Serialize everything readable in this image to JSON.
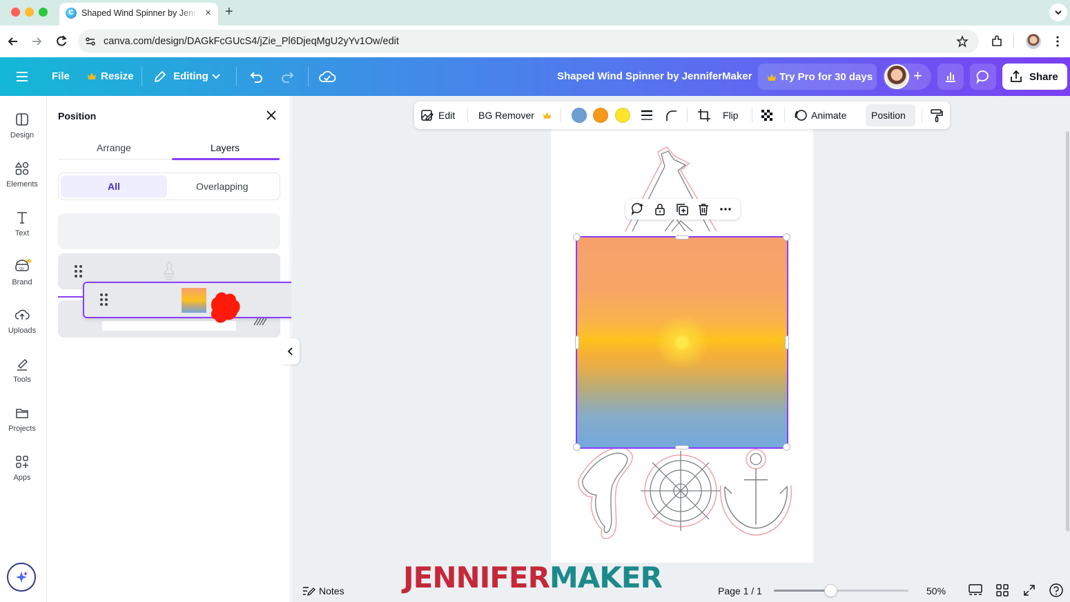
{
  "browser": {
    "tab_title": "Shaped Wind Spinner by JenniferMaker",
    "tab_close": "×",
    "new_tab": "+",
    "url": "canva.com/design/DAGkFcGUcS4/jZie_Pl6DjeqMgU2yYv1Ow/edit"
  },
  "toolbar": {
    "file": "File",
    "resize": "Resize",
    "editing": "Editing",
    "design_title": "Shaped Wind Spinner by JenniferMaker",
    "try_pro": "Try Pro for 30 days",
    "share": "Share"
  },
  "rail": {
    "items": [
      {
        "label": "Design"
      },
      {
        "label": "Elements"
      },
      {
        "label": "Text"
      },
      {
        "label": "Brand"
      },
      {
        "label": "Uploads"
      },
      {
        "label": "Tools"
      },
      {
        "label": "Projects"
      },
      {
        "label": "Apps"
      }
    ]
  },
  "panel": {
    "title": "Position",
    "tabs": [
      "Arrange",
      "Layers"
    ],
    "active_tab": "Layers",
    "filters": [
      "All",
      "Overlapping"
    ],
    "active_filter": "All"
  },
  "context_toolbar": {
    "edit": "Edit",
    "bg_remover": "BG Remover",
    "flip": "Flip",
    "animate": "Animate",
    "position": "Position",
    "swatches": [
      "#6d9fd3",
      "#f59a1c",
      "#fde52c"
    ]
  },
  "bottom": {
    "notes": "Notes",
    "page": "Page 1 / 1",
    "zoom": "50%",
    "zoom_fraction": 0.42
  },
  "watermark": {
    "part1": "JENNIFER",
    "part2": "MAKER"
  },
  "colors": {
    "accent": "#8b3dff",
    "crown": "#f5b91f"
  }
}
